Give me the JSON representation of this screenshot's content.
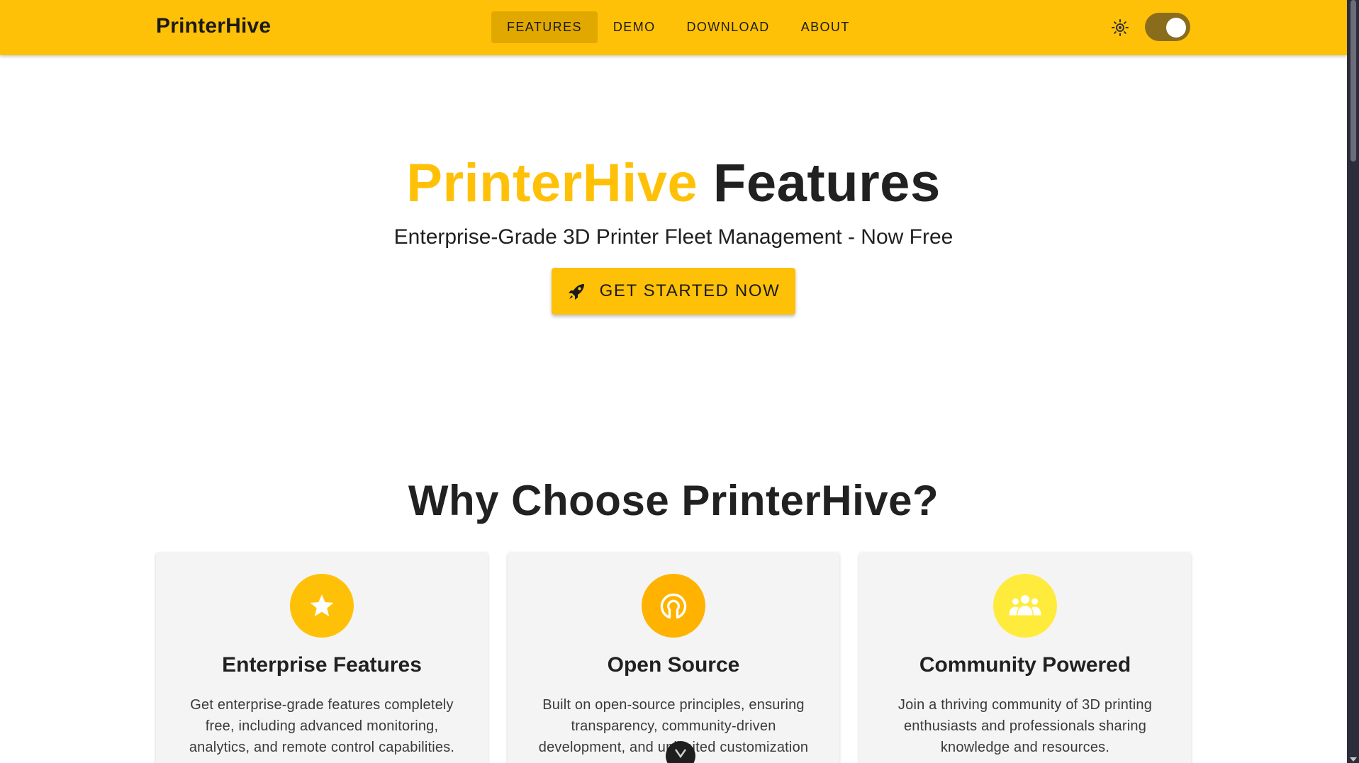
{
  "appbar": {
    "brand": "PrinterHive",
    "nav": [
      {
        "label": "FEATURES",
        "active": true
      },
      {
        "label": "DEMO",
        "active": false
      },
      {
        "label": "DOWNLOAD",
        "active": false
      },
      {
        "label": "ABOUT",
        "active": false
      }
    ],
    "theme_icon": "brightness-icon",
    "theme_toggle_on": true
  },
  "hero": {
    "title_accent": "PrinterHive",
    "title_rest": "Features",
    "subtitle": "Enterprise-Grade 3D Printer Fleet Management - Now Free",
    "cta_label": "GET STARTED NOW",
    "cta_icon": "rocket-icon"
  },
  "section": {
    "title": "Why Choose PrinterHive?",
    "cards": [
      {
        "icon": "star-icon",
        "icon_color": "#FFC107",
        "title": "Enterprise Features",
        "text": "Get enterprise-grade features completely free, including advanced monitoring, analytics, and remote control capabilities."
      },
      {
        "icon": "open-source-icon",
        "icon_color": "#FFB300",
        "title": "Open Source",
        "text": "Built on open-source principles, ensuring transparency, community-driven development, and unlimited customization"
      },
      {
        "icon": "community-icon",
        "icon_color": "#FFEB3B",
        "title": "Community Powered",
        "text": "Join a thriving community of 3D printing enthusiasts and professionals sharing knowledge and resources."
      }
    ]
  },
  "colors": {
    "primary": "#FFC107",
    "active_nav": "#E1A800",
    "toggle_track": "#8a6d1c"
  }
}
